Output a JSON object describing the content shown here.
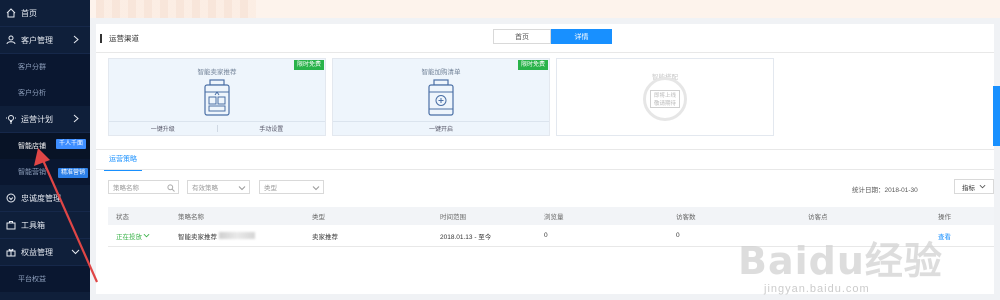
{
  "sidebar": {
    "items": [
      {
        "label": "首页"
      },
      {
        "label": "客户管理"
      },
      {
        "label": "客户分群"
      },
      {
        "label": "客户分析"
      },
      {
        "label": "运营计划"
      },
      {
        "label": "智能店铺",
        "tag": "千人千面"
      },
      {
        "label": "智能营销",
        "tag": "精准营销"
      },
      {
        "label": "忠诚度管理"
      },
      {
        "label": "工具箱"
      },
      {
        "label": "权益管理"
      },
      {
        "label": "平台权益"
      }
    ]
  },
  "header": {
    "title": "运营渠道",
    "tabs": [
      {
        "label": "首页"
      },
      {
        "label": "详情"
      }
    ]
  },
  "cards": [
    {
      "title": "智能卖家推荐",
      "badge": "限时免费",
      "actions": [
        "一键升级",
        "手动设置"
      ]
    },
    {
      "title": "智能加购清单",
      "badge": "限时免费",
      "actions": [
        "一键开启"
      ]
    },
    {
      "title": "智能搭配",
      "stamp_lines": [
        "即将上线",
        "敬请期待"
      ]
    }
  ],
  "strategy": {
    "tab": "运营策略",
    "filters": {
      "name_placeholder": "策略名称",
      "status_select": "有效策略",
      "type_select": "类型"
    },
    "stat_date": "统计日期：2018-01-30",
    "metric_button": "指标",
    "table": {
      "headers": [
        "状态",
        "策略名称",
        "类型",
        "时间范围",
        "浏览量",
        "访客数",
        "访客点",
        "操作"
      ],
      "rows": [
        {
          "status": "正在投放",
          "name": "智能卖家推荐",
          "type": "卖家推荐",
          "time": "2018.01.13 - 至今",
          "views": "0",
          "visitors": "0",
          "rate": "",
          "op": "查看"
        }
      ]
    }
  },
  "watermark": {
    "brand": "Baidu经验",
    "url": "jingyan.baidu.com"
  },
  "colors": {
    "sidebar_bg": "#0f1f3a",
    "accent": "#1890ff",
    "badge_green": "#29b34a",
    "arrow_red": "#e04646"
  }
}
